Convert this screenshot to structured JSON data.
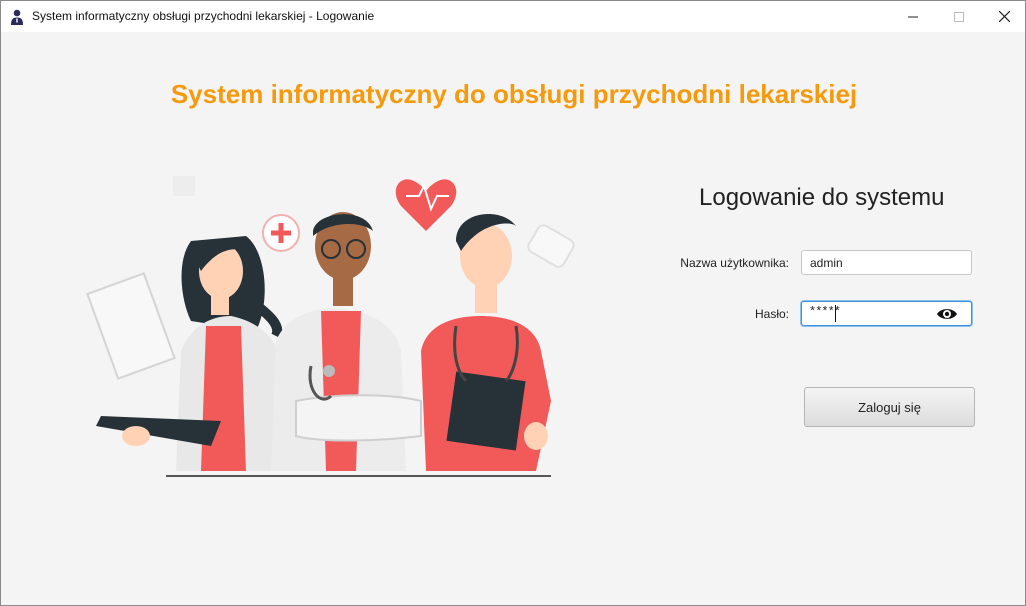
{
  "window": {
    "title": "System informatyczny obsługi przychodni lekarskiej - Logowanie",
    "icon": "user-icon"
  },
  "header": {
    "headline": "System informatyczny do obsługi przychodni lekarskiej",
    "accent_color": "#f59a0c"
  },
  "illustration": {
    "name": "medical-staff-illustration",
    "accent_color": "#f25a5a"
  },
  "login": {
    "title": "Logowanie do systemu",
    "username_label": "Nazwa użytkownika:",
    "username_value": "admin",
    "password_label": "Hasło:",
    "password_value": "*****",
    "password_toggle_icon": "eye-icon",
    "submit_label": "Zaloguj się"
  }
}
